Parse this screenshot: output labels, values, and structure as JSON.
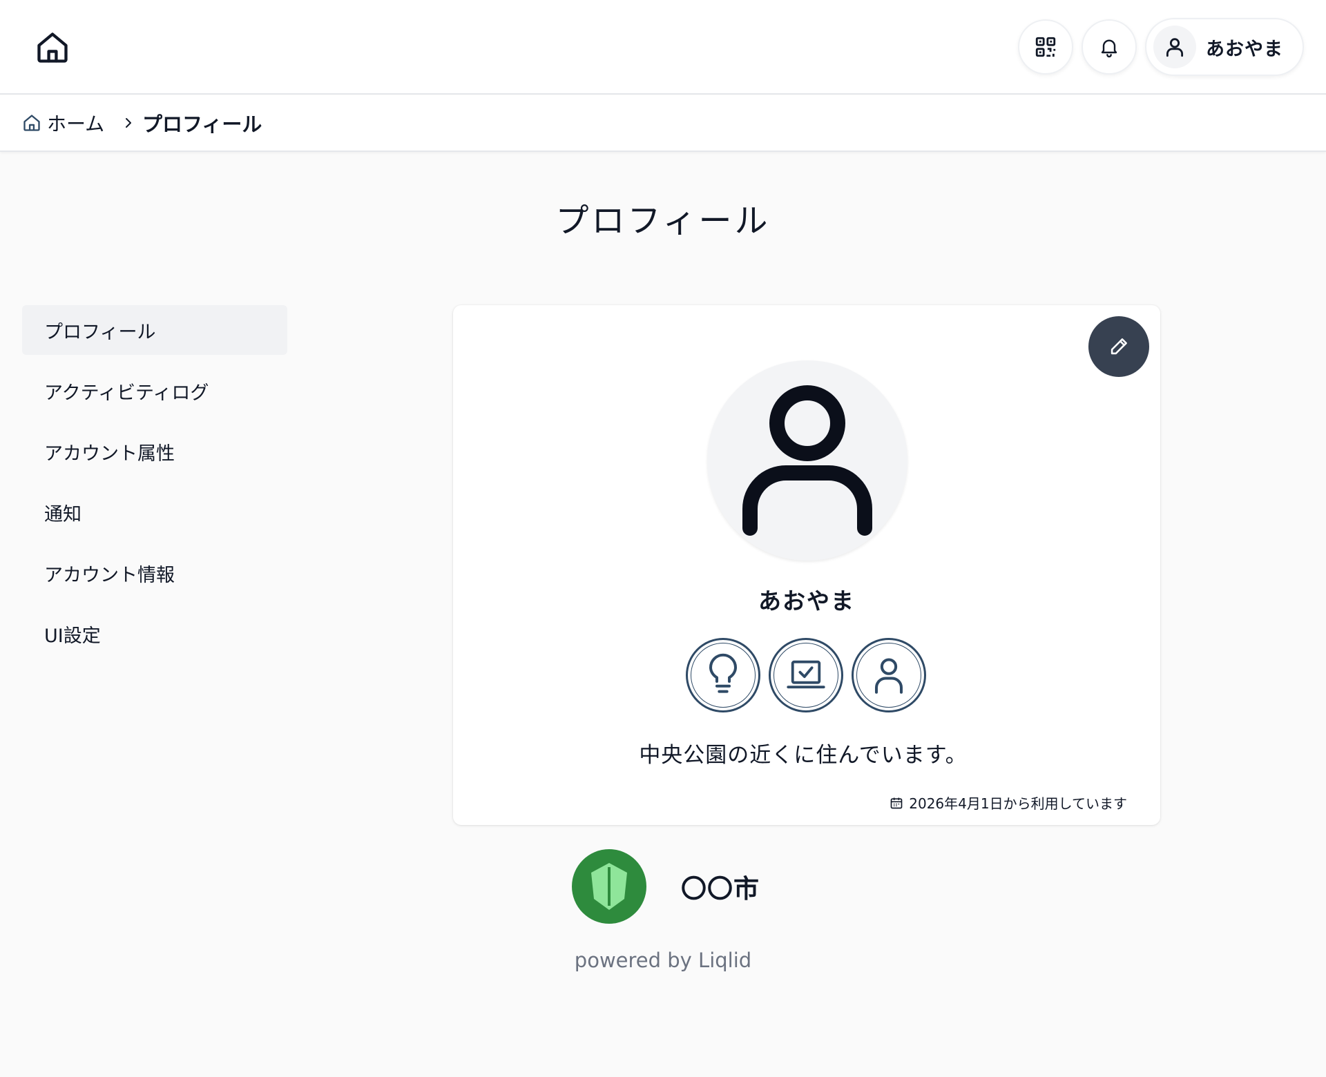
{
  "header": {
    "home_icon": "home-icon",
    "qr_icon": "qr-code-icon",
    "bell_icon": "bell-icon",
    "user_name": "あおやま"
  },
  "breadcrumb": {
    "home_label": "ホーム",
    "current": "プロフィール"
  },
  "page": {
    "title": "プロフィール"
  },
  "sidebar": {
    "items": [
      {
        "label": "プロフィール",
        "active": true
      },
      {
        "label": "アクティビティログ",
        "active": false
      },
      {
        "label": "アカウント属性",
        "active": false
      },
      {
        "label": "通知",
        "active": false
      },
      {
        "label": "アカウント情報",
        "active": false
      },
      {
        "label": "UI設定",
        "active": false
      }
    ]
  },
  "profile": {
    "name": "あおやま",
    "bio": "中央公園の近くに住んでいます。",
    "since": "2026年4月1日から利用しています",
    "badges": [
      "lightbulb-icon",
      "laptop-check-icon",
      "user-icon"
    ]
  },
  "footer": {
    "org_name": "〇〇市",
    "powered_by": "powered by Liqlid"
  },
  "colors": {
    "edit_button": "#374151",
    "badge_border": "#2f4a66",
    "org_green": "#2e8b3d",
    "org_leaf": "#8fe59a"
  }
}
